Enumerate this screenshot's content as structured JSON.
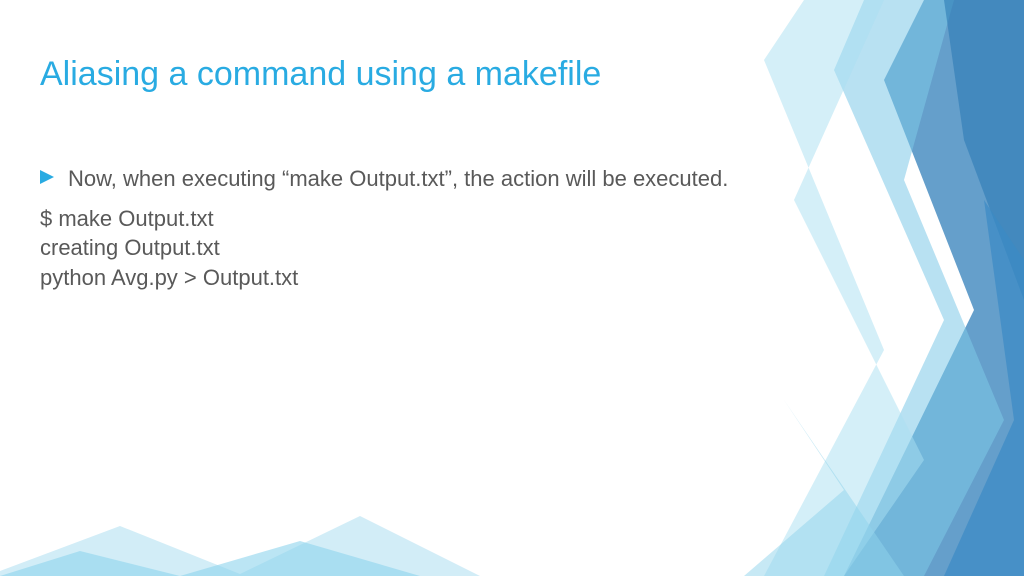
{
  "title": "Aliasing a command using  a makefile",
  "bullet": {
    "text": "Now, when executing “make Output.txt”, the action will be executed."
  },
  "code": "$ make Output.txt\ncreating Output.txt\npython Avg.py > Output.txt",
  "colors": {
    "accent": "#29abe2",
    "body": "#595959"
  }
}
